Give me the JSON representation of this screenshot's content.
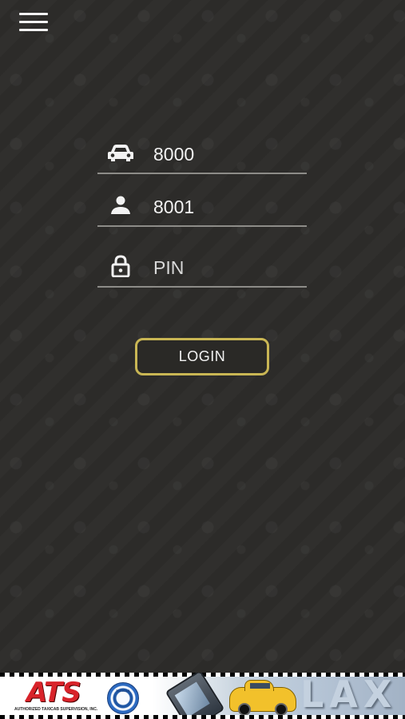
{
  "menu": {
    "icon": "hamburger-menu-icon"
  },
  "login_form": {
    "fields": [
      {
        "icon": "car-icon",
        "value": "8000",
        "placeholder": ""
      },
      {
        "icon": "person-icon",
        "value": "8001",
        "placeholder": ""
      },
      {
        "icon": "lock-icon",
        "value": "",
        "placeholder": "PIN"
      }
    ],
    "login_label": "LOGIN"
  },
  "ad_banner": {
    "brand": "ATS",
    "brand_subtitle": "AUTHORIZED TAXICAB SUPERVISION, INC.",
    "seal_text": "TAXICAB",
    "location_text": "LAX"
  },
  "colors": {
    "background": "#2c2b29",
    "accent": "#c9b654",
    "text": "#f2f2f2",
    "input_underline": "#8d8c88"
  }
}
